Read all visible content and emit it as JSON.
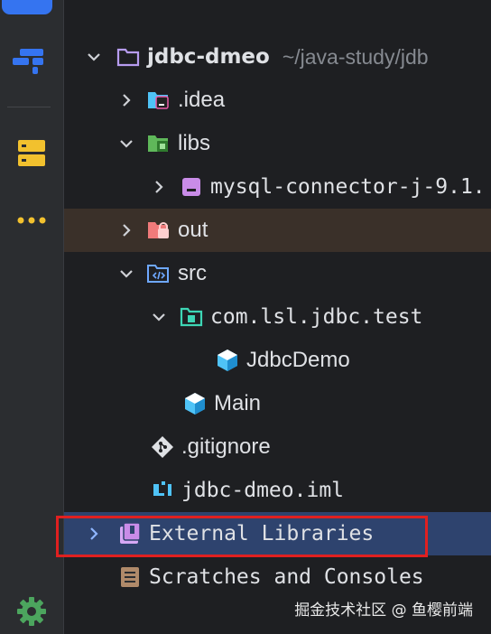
{
  "tree": {
    "project": {
      "name": "jdbc-dmeo",
      "path": "~/java-study/jdb"
    },
    "idea_folder": ".idea",
    "libs_folder": "libs",
    "mysql_jar": "mysql-connector-j-9.1.",
    "out_folder": "out",
    "src_folder": "src",
    "package": "com.lsl.jdbc.test",
    "jdbc_demo_class": "JdbcDemo",
    "main_class": "Main",
    "gitignore": ".gitignore",
    "iml_file": "jdbc-dmeo.iml",
    "external_libraries": "External Libraries",
    "scratches": "Scratches and Consoles"
  },
  "watermark": "掘金技术社区 @ 鱼樱前端",
  "colors": {
    "sidebar": "#2b2d30",
    "background": "#1e1f22",
    "selection": "#2e436e",
    "excluded_row": "#3a3029",
    "highlight_box": "#e02020",
    "folder_icon": "#b79cf0",
    "package_icon": "#3dd6b5",
    "class_icon": "#4fc3f7",
    "settings_icon": "#4ca55e"
  },
  "icons": {
    "toolstrip": [
      "project-icon",
      "structure-icon",
      "database-icon",
      "more-icon",
      "settings-icon"
    ]
  }
}
